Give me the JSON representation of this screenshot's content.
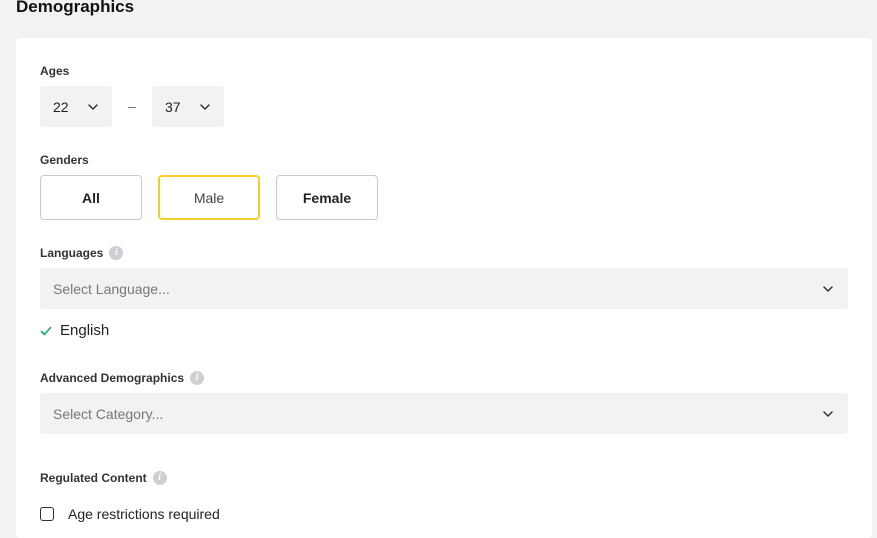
{
  "page": {
    "title": "Demographics"
  },
  "ages": {
    "label": "Ages",
    "min": "22",
    "separator": "–",
    "max": "37"
  },
  "genders": {
    "label": "Genders",
    "options": [
      "All",
      "Male",
      "Female"
    ],
    "selected": "Male"
  },
  "languages": {
    "label": "Languages",
    "info_icon": "i",
    "placeholder": "Select Language...",
    "selected": [
      "English"
    ]
  },
  "advanced": {
    "label": "Advanced Demographics",
    "info_icon": "i",
    "placeholder": "Select Category..."
  },
  "regulated": {
    "label": "Regulated Content",
    "info_icon": "i",
    "checkbox_label": "Age restrictions required",
    "checked": false
  },
  "colors": {
    "selected_border": "#f5d029",
    "check": "#1aab6b",
    "input_bg": "#f2f2f4"
  }
}
